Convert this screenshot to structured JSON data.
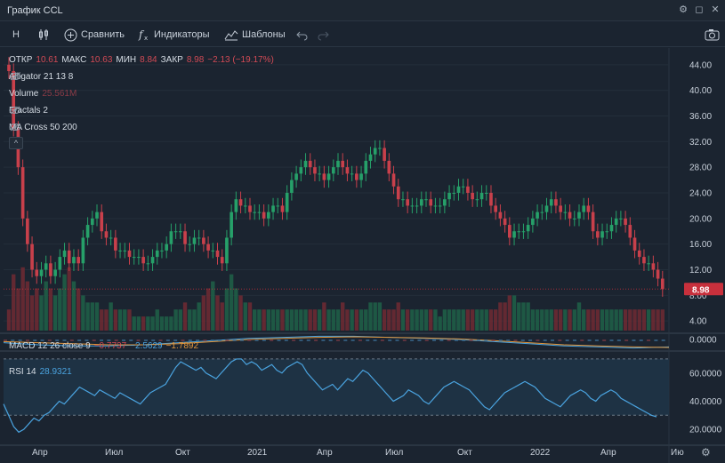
{
  "window": {
    "title": "График CCL"
  },
  "toolbar": {
    "interval": "H",
    "compare_label": "Сравнить",
    "indicators_label": "Индикаторы",
    "templates_label": "Шаблоны"
  },
  "ohlc": {
    "open_label": "ОТКР",
    "open": "10.61",
    "high_label": "МАКС",
    "high": "10.63",
    "low_label": "МИН",
    "low": "8.84",
    "close_label": "ЗАКР",
    "close": "8.98",
    "change": "−2.13 (−19.17%)"
  },
  "indicators": {
    "alligator": "Alligator 21 13 8",
    "volume_label": "Volume",
    "volume_value": "25.561M",
    "fractals": "Fractals 2",
    "ma_cross": "MA Cross 50 200",
    "macd_label": "MACD 12 26 close 9",
    "macd_values": [
      "−0.7737",
      "−2.5629",
      "−1.7892"
    ],
    "rsi_label": "RSI 14",
    "rsi_value": "28.9321"
  },
  "colors": {
    "up": "#26a069",
    "down": "#c8404b",
    "macd": "#4aa3df",
    "signal": "#e0953c",
    "rsi": "#4aa3df",
    "last_price_bg": "#c8303c"
  },
  "chart_data": [
    {
      "type": "candlestick",
      "name": "CCL",
      "y_ticks": [
        "4.00",
        "8.00",
        "12.00",
        "16.00",
        "20.00",
        "24.00",
        "28.00",
        "32.00",
        "36.00",
        "40.00",
        "44.00"
      ],
      "last_price": "8.98",
      "x_ticks": [
        "Апр",
        "Июл",
        "Окт",
        "2021",
        "Апр",
        "Июл",
        "Окт",
        "2022",
        "Апр",
        "Ию"
      ],
      "closes": [
        43,
        34,
        28,
        20,
        16,
        12,
        11,
        12,
        13,
        11,
        12,
        14,
        15,
        13,
        14,
        13,
        17,
        19,
        20,
        21,
        18,
        17,
        17,
        15,
        15,
        15,
        14,
        14,
        14,
        13,
        13,
        14,
        15,
        15,
        16,
        18,
        18,
        18,
        16,
        16,
        17,
        17,
        16,
        15,
        15,
        14,
        13,
        17,
        21,
        23,
        22,
        22,
        21,
        21,
        21,
        20,
        21,
        22,
        22,
        21,
        24,
        26,
        27,
        28,
        29,
        28,
        27,
        27,
        26,
        27,
        28,
        29,
        28,
        27,
        27,
        26,
        27,
        29,
        30,
        31,
        31,
        29,
        27,
        25,
        23,
        23,
        22,
        22,
        22,
        23,
        23,
        22,
        22,
        22,
        23,
        24,
        24,
        25,
        25,
        24,
        23,
        23,
        24,
        24,
        22,
        21,
        20,
        19,
        17,
        18,
        18,
        18,
        19,
        20,
        21,
        21,
        22,
        23,
        22,
        21,
        21,
        20,
        20,
        21,
        22,
        21,
        18,
        17,
        18,
        18,
        19,
        20,
        20,
        19,
        17,
        15,
        14,
        13,
        13,
        12,
        10.61,
        8.98
      ],
      "opens": [
        44,
        43,
        34,
        28,
        20,
        16,
        12,
        11,
        12,
        13,
        11,
        12,
        14,
        15,
        13,
        14,
        13,
        17,
        19,
        20,
        21,
        18,
        17,
        17,
        15,
        15,
        15,
        14,
        14,
        14,
        13,
        13,
        14,
        15,
        15,
        16,
        18,
        18,
        18,
        16,
        16,
        17,
        17,
        16,
        15,
        15,
        14,
        13,
        17,
        21,
        23,
        22,
        22,
        21,
        21,
        21,
        20,
        21,
        22,
        22,
        21,
        24,
        26,
        27,
        28,
        29,
        28,
        27,
        27,
        26,
        27,
        28,
        29,
        28,
        27,
        27,
        26,
        27,
        29,
        30,
        31,
        31,
        29,
        27,
        25,
        23,
        23,
        22,
        22,
        22,
        23,
        23,
        22,
        22,
        22,
        23,
        24,
        24,
        25,
        25,
        24,
        23,
        23,
        24,
        24,
        22,
        21,
        20,
        19,
        17,
        18,
        18,
        18,
        19,
        20,
        21,
        21,
        22,
        23,
        22,
        21,
        21,
        20,
        20,
        21,
        22,
        21,
        18,
        17,
        18,
        18,
        19,
        20,
        20,
        19,
        17,
        15,
        14,
        13,
        13,
        12,
        10.61
      ]
    },
    {
      "type": "bar",
      "name": "Volume",
      "values": [
        3,
        8,
        6,
        9,
        7,
        5,
        6,
        5,
        7,
        6,
        5,
        6,
        8,
        9,
        7,
        6,
        5,
        4,
        4,
        4,
        3,
        3,
        4,
        3,
        3,
        3,
        3,
        2,
        2,
        2,
        2,
        2,
        3,
        2,
        2,
        2,
        3,
        3,
        4,
        3,
        3,
        4,
        5,
        6,
        7,
        5,
        4,
        6,
        8,
        6,
        5,
        4,
        4,
        3,
        3,
        3,
        3,
        3,
        3,
        3,
        3,
        3,
        3,
        3,
        3,
        3,
        3,
        3,
        4,
        3,
        3,
        3,
        4,
        3,
        3,
        3,
        3,
        3,
        4,
        4,
        4,
        3,
        3,
        3,
        4,
        3,
        3,
        3,
        3,
        3,
        3,
        3,
        3,
        2,
        3,
        3,
        3,
        3,
        3,
        3,
        3,
        3,
        3,
        3,
        3,
        3,
        4,
        4,
        5,
        5,
        4,
        4,
        4,
        3,
        3,
        3,
        3,
        3,
        3,
        3,
        3,
        3,
        3,
        4,
        3,
        3,
        3,
        3,
        3,
        3,
        3,
        3,
        3,
        3,
        3,
        3,
        3,
        3,
        3,
        3,
        3,
        3
      ]
    },
    {
      "type": "line",
      "name": "MACD",
      "y_ticks": [
        "0.0000"
      ],
      "series": [
        {
          "name": "MACD",
          "values": [
            -0.3,
            -0.5,
            -0.6,
            -0.6,
            -0.5,
            -0.3,
            -0.1,
            0.1,
            0.2,
            0.3,
            0.3,
            0.2,
            0.1,
            0.0,
            -0.2,
            -0.4,
            -0.6,
            -0.7,
            -0.8,
            -0.7
          ]
        },
        {
          "name": "Signal",
          "values": [
            -0.2,
            -0.3,
            -0.4,
            -0.5,
            -0.5,
            -0.4,
            -0.2,
            0.0,
            0.1,
            0.2,
            0.25,
            0.2,
            0.15,
            0.05,
            -0.1,
            -0.3,
            -0.5,
            -0.6,
            -0.7,
            -0.75
          ]
        }
      ]
    },
    {
      "type": "line",
      "name": "RSI 14",
      "y_ticks": [
        "20.0000",
        "40.0000",
        "60.0000"
      ],
      "ylim": [
        10,
        75
      ],
      "bands": [
        30,
        70
      ],
      "values": [
        38,
        30,
        22,
        18,
        20,
        24,
        28,
        26,
        30,
        32,
        36,
        40,
        38,
        42,
        46,
        50,
        48,
        46,
        44,
        48,
        46,
        44,
        42,
        46,
        44,
        42,
        40,
        38,
        42,
        46,
        48,
        50,
        52,
        58,
        64,
        68,
        66,
        64,
        62,
        64,
        60,
        58,
        56,
        60,
        64,
        68,
        70,
        70,
        66,
        68,
        66,
        62,
        64,
        66,
        62,
        60,
        64,
        66,
        68,
        66,
        60,
        56,
        52,
        48,
        50,
        52,
        48,
        52,
        56,
        54,
        58,
        62,
        60,
        56,
        52,
        48,
        44,
        40,
        42,
        44,
        48,
        46,
        44,
        40,
        38,
        42,
        46,
        50,
        52,
        54,
        52,
        50,
        48,
        44,
        40,
        36,
        34,
        38,
        42,
        46,
        48,
        50,
        52,
        54,
        52,
        50,
        46,
        42,
        40,
        38,
        36,
        40,
        44,
        46,
        48,
        46,
        42,
        40,
        44,
        46,
        48,
        46,
        42,
        40,
        38,
        36,
        34,
        32,
        30,
        28.93
      ]
    }
  ]
}
